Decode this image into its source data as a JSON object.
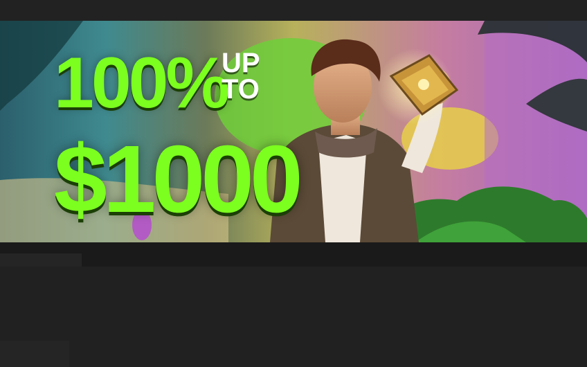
{
  "banner": {
    "headline_percent": "100%",
    "headline_upto": "UP TO",
    "headline_amount": "$1000"
  },
  "colors": {
    "accent_green": "#7CFF1F",
    "page_background": "#1e1e1e"
  }
}
